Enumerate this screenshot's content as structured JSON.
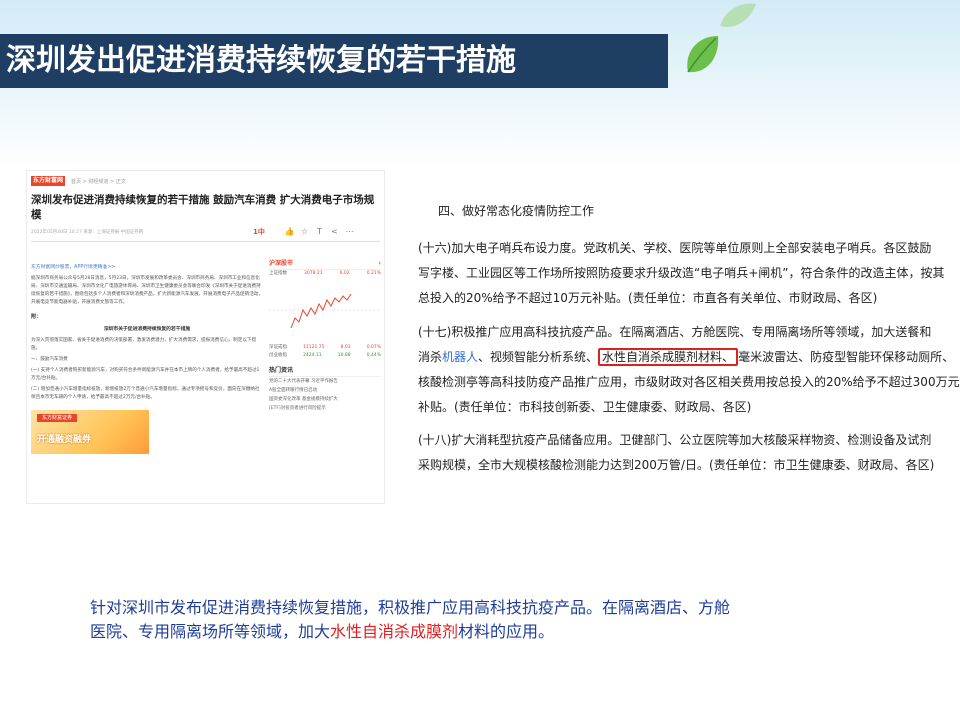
{
  "title": "深圳发出促进消费持续恢复的若干措施",
  "article": {
    "logo": "东方财富网",
    "breadcrumb": "首页 > 财经频道 > 正文",
    "headline": "深圳发布促进消费持续恢复的若干措施 鼓励汽车消费 扩大消费电子市场规模",
    "meta": "2022年05月30日 10:27   来源：上海证券报·中国证券网",
    "zan": "1中",
    "link": "东方财富网炒股票，APP行情更精准>>",
    "paragraphs": [
      "据深圳市商务局公众号5月28日消息，5月23日，深圳市发展和改革委员会、深圳市商务局、深圳市工业和信息化局、深圳市交通运输局、深圳市文化广电旅游体育局、深圳市卫生健康委员会等联合印发《深圳市关于促进消费持续恢复的若干措施》，围绕包括多个人消费者和深圳消费产品，扩大新能源汽车发展，开展消费电子产品促销活动，开展电竞节能电器补贴，开展消费文旅等工作。"
    ],
    "notice_head": "附：",
    "notice_title": "深圳市关于促进消费持续恢复的若干措施",
    "intro": "为深入贯彻落实国家、省关于促进消费的决策部署，激发消费潜力，扩大消费需求，提振消费信心，制定以下措施。",
    "section1": "一、鼓励汽车消费",
    "item1": "(一) 支持个人消费者购买新能源汽车，对购买符合条件新能源汽车并在本市上牌的个人消费者，给予最高不超过1万元/台补贴。",
    "item2": "(二) 增加普通小汽车增量指标投放，新增投放2万个普通小汽车增量指标，通过专项摇号和竞价，面向在深缴纳社保且本市无车辆的个人申请，给予最高不超过2万元/台补贴。",
    "ad_logo": "东方财富证券",
    "ad_text": "开通融资融券",
    "market": {
      "tab": "沪深股市",
      "more": "›",
      "rows": [
        {
          "name": "上证指数",
          "value": "3078.21",
          "change": "6.02",
          "pct": "0.21%"
        },
        {
          "name": "深证成指",
          "value": "11121.75",
          "change": "8.03",
          "pct": "0.07%"
        },
        {
          "name": "创业板指",
          "value": "2424.11",
          "change": "10.88",
          "pct": "0.44%"
        }
      ]
    },
    "hot": {
      "title": "热门资讯",
      "items": [
        "党的二十大代表开幕 习近平作报告",
        "A股全面转暖行情已启动",
        "国资委深化改革 基金规模持续扩大",
        "[ETF]对投资者进行风险提示"
      ]
    }
  },
  "policy": {
    "section": "四、做好常态化疫情防控工作",
    "items": [
      {
        "lines": [
          "(十六)加大电子哨兵布设力度。党政机关、学校、医院等单位原则上全部安装电子哨兵。各区鼓励",
          "写字楼、工业园区等工作场所按照防疫要求升级改造“电子哨兵+闸机”，符合条件的改造主体，按其",
          "总投入的20%给予不超过10万元补贴。(责任单位：市直各有关单位、市财政局、各区)"
        ]
      },
      {
        "line1": "(十七)积极推广应用高科技抗疫产品。在隔离酒店、方舱医院、专用隔离场所等领域，加大送餐和",
        "line2_a": "消杀",
        "line2_link": "机器人",
        "line2_b": "、视频智能分析系统、",
        "line2_box": "水性自消杀成膜剂材料、",
        "line2_c": "毫米波雷达、防疫型智能环保移动厕所、",
        "line3": "核酸检测亭等高科技防疫产品推广应用，市级财政对各区相关费用按总投入的20%给予不超过300万元",
        "line4": "补贴。(责任单位：市科技创新委、卫生健康委、财政局、各区)"
      },
      {
        "lines": [
          "(十八)扩大消耗型抗疫产品储备应用。卫健部门、公立医院等加大核酸采样物资、检测设备及试剂",
          "采购规模，全市大规模核酸检测能力达到200万管/日。(责任单位：市卫生健康委、财政局、各区)"
        ]
      }
    ]
  },
  "caption": {
    "line1": "针对深圳市发布促进消费持续恢复措施，积极推广应用高科技抗疫产品。在隔离酒店、方舱",
    "line2_a": "医院、专用隔离场所等领域，加大",
    "line2_red": "水性自消杀成膜剂",
    "line2_b": "材料的应用。"
  },
  "colors": {
    "title_bar": "#1f3e63",
    "caption_text": "#1e3d9a",
    "highlight_red": "#e02020",
    "link_blue": "#2f6fd6"
  }
}
